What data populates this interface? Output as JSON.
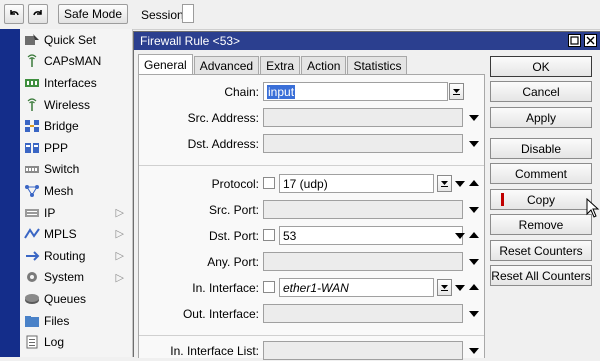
{
  "toolbar": {
    "undo_icon": "undo-icon",
    "redo_icon": "redo-icon",
    "safe_mode_label": "Safe Mode",
    "session_label": "Session:"
  },
  "sidebar": {
    "items": [
      {
        "label": "Quick Set",
        "icon": "quick-set-icon",
        "submenu": false
      },
      {
        "label": "CAPsMAN",
        "icon": "capsman-icon",
        "submenu": false
      },
      {
        "label": "Interfaces",
        "icon": "interfaces-icon",
        "submenu": false
      },
      {
        "label": "Wireless",
        "icon": "wireless-icon",
        "submenu": false
      },
      {
        "label": "Bridge",
        "icon": "bridge-icon",
        "submenu": false
      },
      {
        "label": "PPP",
        "icon": "ppp-icon",
        "submenu": false
      },
      {
        "label": "Switch",
        "icon": "switch-icon",
        "submenu": false
      },
      {
        "label": "Mesh",
        "icon": "mesh-icon",
        "submenu": false
      },
      {
        "label": "IP",
        "icon": "ip-icon",
        "submenu": true
      },
      {
        "label": "MPLS",
        "icon": "mpls-icon",
        "submenu": true
      },
      {
        "label": "Routing",
        "icon": "routing-icon",
        "submenu": true
      },
      {
        "label": "System",
        "icon": "system-icon",
        "submenu": true
      },
      {
        "label": "Queues",
        "icon": "queues-icon",
        "submenu": false
      },
      {
        "label": "Files",
        "icon": "files-icon",
        "submenu": false
      },
      {
        "label": "Log",
        "icon": "log-icon",
        "submenu": false
      }
    ]
  },
  "dialog": {
    "title": "Firewall Rule <53>",
    "tabs": [
      {
        "label": "General",
        "active": true
      },
      {
        "label": "Advanced",
        "active": false
      },
      {
        "label": "Extra",
        "active": false
      },
      {
        "label": "Action",
        "active": false
      },
      {
        "label": "Statistics",
        "active": false
      }
    ],
    "fields": {
      "chain": {
        "label": "Chain:",
        "value": "input"
      },
      "src_address": {
        "label": "Src. Address:",
        "value": ""
      },
      "dst_address": {
        "label": "Dst. Address:",
        "value": ""
      },
      "protocol": {
        "label": "Protocol:",
        "value": "17 (udp)"
      },
      "src_port": {
        "label": "Src. Port:",
        "value": ""
      },
      "dst_port": {
        "label": "Dst. Port:",
        "value": "53"
      },
      "any_port": {
        "label": "Any. Port:",
        "value": ""
      },
      "in_interface": {
        "label": "In. Interface:",
        "value": "ether1-WAN"
      },
      "out_interface": {
        "label": "Out. Interface:",
        "value": ""
      },
      "in_interface_list": {
        "label": "In. Interface List:",
        "value": ""
      }
    },
    "buttons": {
      "ok": "OK",
      "cancel": "Cancel",
      "apply": "Apply",
      "disable": "Disable",
      "comment": "Comment",
      "copy": "Copy",
      "remove": "Remove",
      "reset_counters": "Reset Counters",
      "reset_all_counters": "Reset All Counters"
    }
  },
  "colors": {
    "titlebar": "#2b3f8f",
    "left_strip": "#142d8a",
    "selection": "#3a6fd8",
    "copy_marker": "#c00000"
  }
}
